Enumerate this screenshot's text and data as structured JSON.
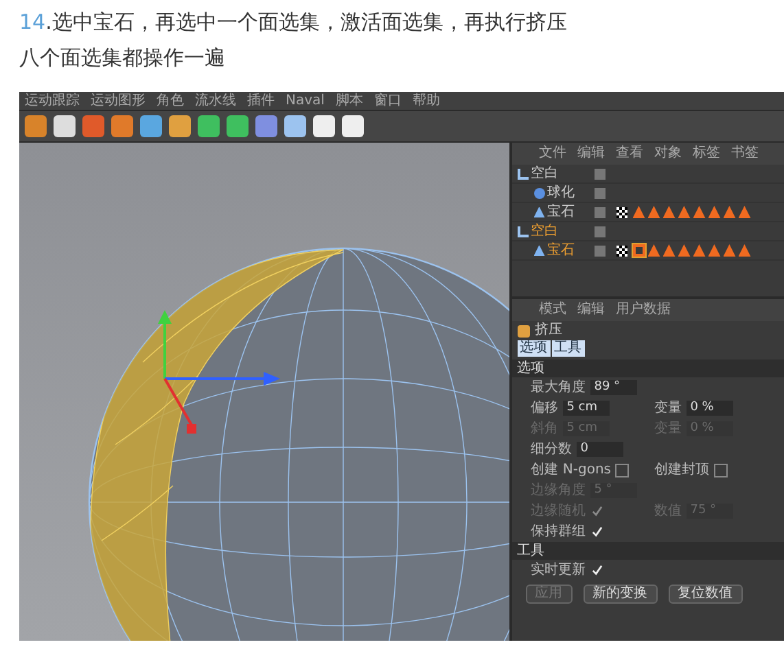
{
  "step": {
    "number": "14",
    "line_1": ".选中宝石，再选中一个面选集，激活面选集，再执行挤压",
    "line_2": "八个面选集都操作一遍"
  },
  "app": {
    "menu": [
      "运动跟踪",
      "运动图形",
      "角色",
      "流水线",
      "插件",
      "Naval",
      "脚本",
      "窗口",
      "帮助"
    ],
    "object_manager": {
      "menu": [
        "文件",
        "编辑",
        "查看",
        "对象",
        "标签",
        "书签"
      ],
      "tree": [
        {
          "label": "空白",
          "kind": "null",
          "selected": false,
          "children": [
            {
              "label": "球化",
              "kind": "sphere",
              "selected": false
            },
            {
              "label": "宝石",
              "kind": "gem",
              "selected": false
            }
          ]
        },
        {
          "label": "空白",
          "kind": "null",
          "selected": true,
          "children": [
            {
              "label": "宝石",
              "kind": "gem",
              "selected": true
            }
          ]
        }
      ]
    },
    "attributes": {
      "menu": [
        "模式",
        "编辑",
        "用户数据"
      ],
      "title": "挤压",
      "tabs": [
        {
          "label": "选项",
          "selected": true
        },
        {
          "label": "工具",
          "selected": true
        }
      ],
      "sections": [
        {
          "title": "选项",
          "rows": [
            [
              {
                "kind": "field",
                "label": "最大角度",
                "value": "89 °",
                "disabled": false
              }
            ],
            [
              {
                "kind": "field",
                "label": "偏移",
                "value": "5 cm",
                "disabled": false
              },
              {
                "kind": "field",
                "label": "变量",
                "value": "0 %",
                "disabled": false
              }
            ],
            [
              {
                "kind": "field",
                "label": "斜角",
                "value": "5 cm",
                "disabled": true
              },
              {
                "kind": "field",
                "label": "变量",
                "value": "0 %",
                "disabled": true
              }
            ],
            [
              {
                "kind": "field",
                "label": "细分数",
                "value": "0",
                "disabled": false
              }
            ],
            [
              {
                "kind": "check",
                "label": "创建 N-gons",
                "checked": false,
                "disabled": false
              },
              {
                "kind": "check",
                "label": "创建封顶",
                "checked": false,
                "disabled": false
              }
            ],
            [
              {
                "kind": "field",
                "label": "边缘角度",
                "value": "5 °",
                "disabled": true
              }
            ],
            [
              {
                "kind": "check",
                "label": "边缘随机",
                "checked": true,
                "disabled": true
              },
              {
                "kind": "field",
                "label": "数值",
                "value": "75 °",
                "disabled": true
              }
            ],
            [
              {
                "kind": "check",
                "label": "保持群组",
                "checked": true,
                "disabled": false
              }
            ]
          ]
        },
        {
          "title": "工具",
          "rows": [
            [
              {
                "kind": "check",
                "label": "实时更新",
                "checked": true,
                "disabled": false
              }
            ]
          ]
        }
      ],
      "buttons": [
        {
          "label": "应用",
          "disabled": true
        },
        {
          "label": "新的变换",
          "disabled": false
        },
        {
          "label": "复位数值",
          "disabled": false
        }
      ]
    }
  }
}
